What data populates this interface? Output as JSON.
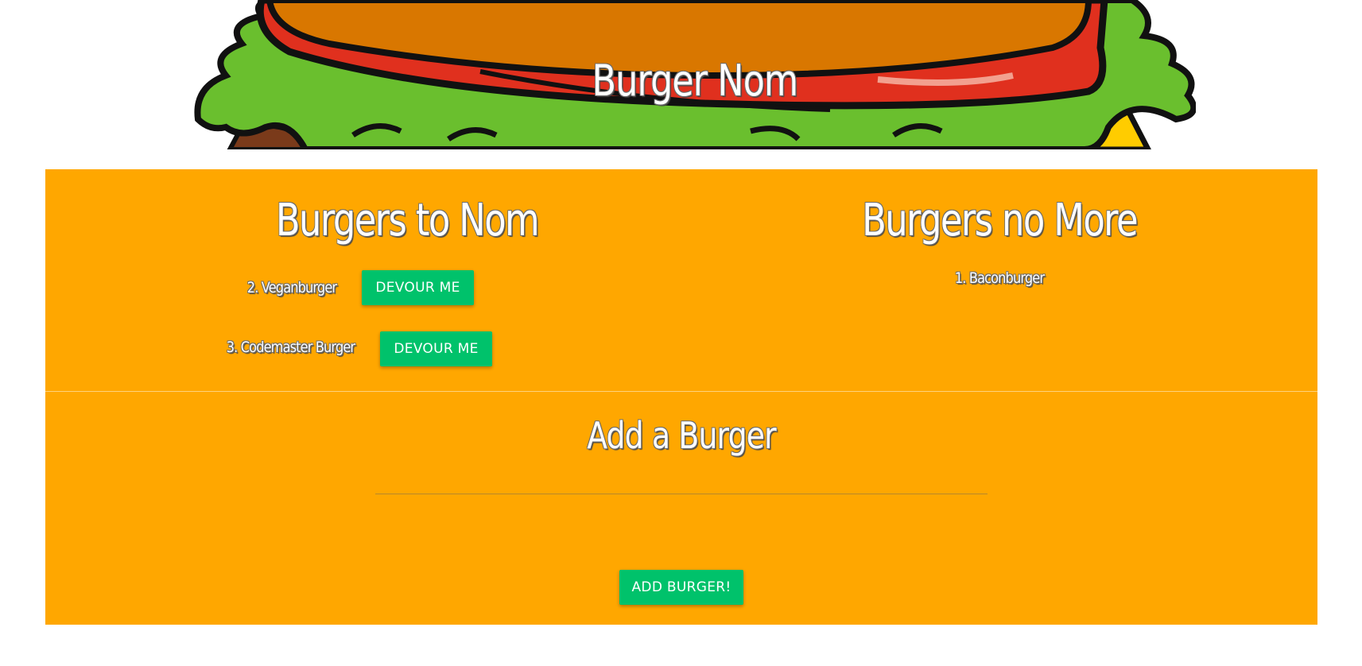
{
  "header": {
    "title": "Burger Nom"
  },
  "to_nom": {
    "heading": "Burgers to Nom",
    "items": [
      {
        "label": "2. Veganburger",
        "button": "DEVOUR ME"
      },
      {
        "label": "3. Codemaster Burger",
        "button": "DEVOUR ME"
      }
    ]
  },
  "no_more": {
    "heading": "Burgers no More",
    "items": [
      {
        "label": "1. Baconburger"
      }
    ]
  },
  "add_form": {
    "heading": "Add a Burger",
    "input_value": "",
    "input_placeholder": "",
    "submit_label": "ADD BURGER!"
  },
  "colors": {
    "panel": "#ffa700",
    "button": "#00c26b",
    "bun": "#d97700",
    "tomato": "#e0301e",
    "lettuce": "#6abf2e",
    "cheese": "#ffcc00",
    "patty": "#7a3a1a"
  }
}
